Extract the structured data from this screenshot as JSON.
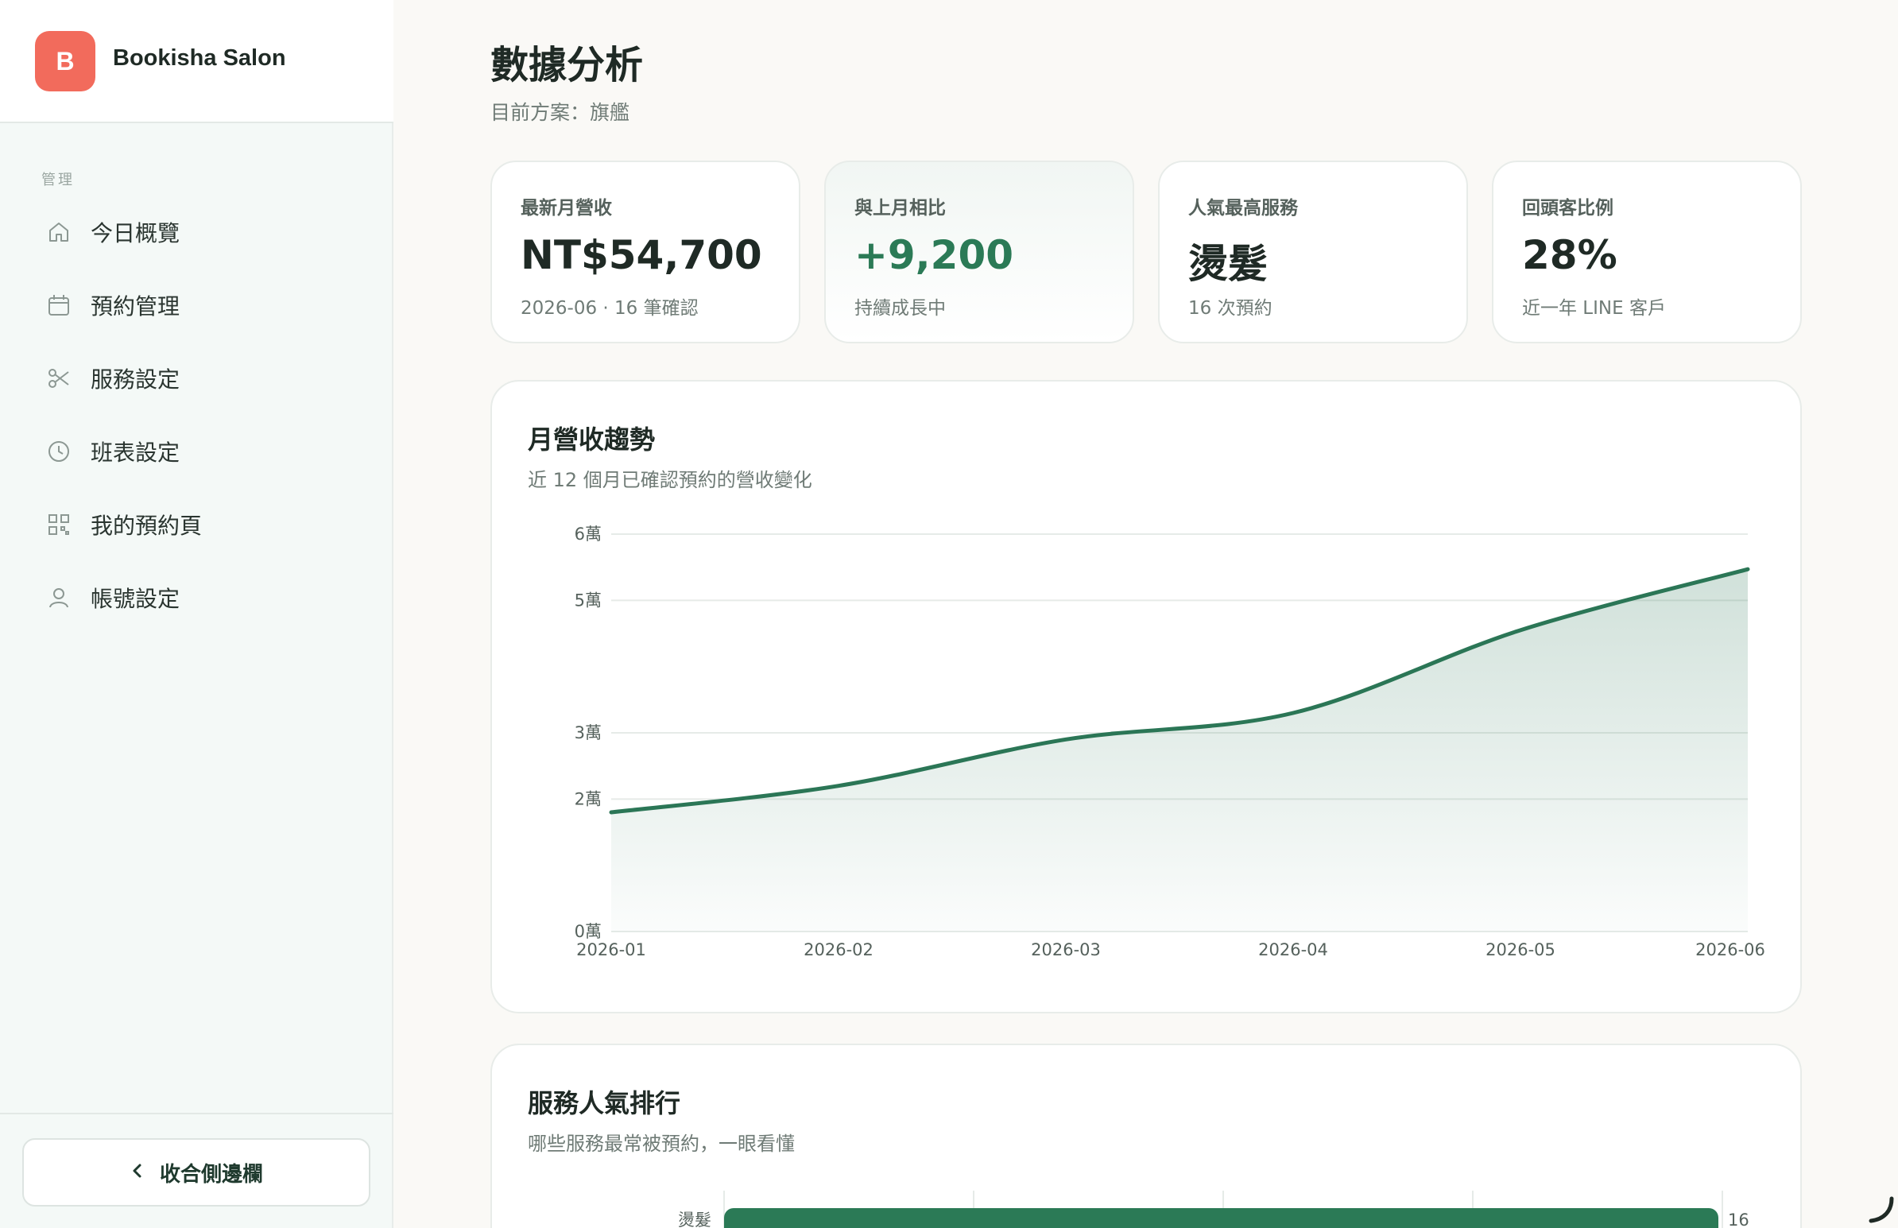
{
  "brand": {
    "logo_letter": "B",
    "name": "Bookisha Salon"
  },
  "sidebar": {
    "section_label": "管理",
    "items": [
      {
        "label": "今日概覽",
        "icon": "home-icon"
      },
      {
        "label": "預約管理",
        "icon": "calendar-icon"
      },
      {
        "label": "服務設定",
        "icon": "scissors-icon"
      },
      {
        "label": "班表設定",
        "icon": "clock-icon"
      },
      {
        "label": "我的預約頁",
        "icon": "qr-code-icon"
      },
      {
        "label": "帳號設定",
        "icon": "user-icon"
      }
    ],
    "collapse_label": "收合側邊欄"
  },
  "page": {
    "title": "數據分析",
    "subtitle": "目前方案：旗艦"
  },
  "stats": [
    {
      "label": "最新月營收",
      "value": "NT$54,700",
      "note": "2026-06 · 16 筆確認"
    },
    {
      "label": "與上月相比",
      "value": "+9,200",
      "note": "持續成長中"
    },
    {
      "label": "人氣最高服務",
      "value": "燙髮",
      "note": "16 次預約"
    },
    {
      "label": "回頭客比例",
      "value": "28%",
      "note": "近一年 LINE 客戶"
    }
  ],
  "revenue_panel": {
    "title": "月營收趨勢",
    "subtitle": "近 12 個月已確認預約的營收變化"
  },
  "ranking_panel": {
    "title": "服務人氣排行",
    "subtitle": "哪些服務最常被預約，一眼看懂"
  },
  "colors": {
    "accent": "#2b7a56",
    "brand": "#f26b5c",
    "line": "#2b7656"
  },
  "chart_data": [
    {
      "type": "area",
      "title": "月營收趨勢",
      "x": [
        "2026-01",
        "2026-02",
        "2026-03",
        "2026-04",
        "2026-05",
        "2026-06"
      ],
      "y_ticks": [
        0,
        20000,
        30000,
        50000,
        60000
      ],
      "y_tick_labels": [
        "0萬",
        "2萬",
        "3萬",
        "5萬",
        "6萬"
      ],
      "y_tick_values": [
        0,
        2,
        3,
        5,
        6
      ],
      "series": [
        {
          "values": [
            18000,
            22000,
            29000,
            33000,
            45500,
            54700
          ]
        }
      ],
      "grid": true
    },
    {
      "type": "bar",
      "title": "服務人氣排行",
      "categories": [
        "燙髮"
      ],
      "values": [
        16
      ],
      "orientation": "horizontal"
    }
  ]
}
